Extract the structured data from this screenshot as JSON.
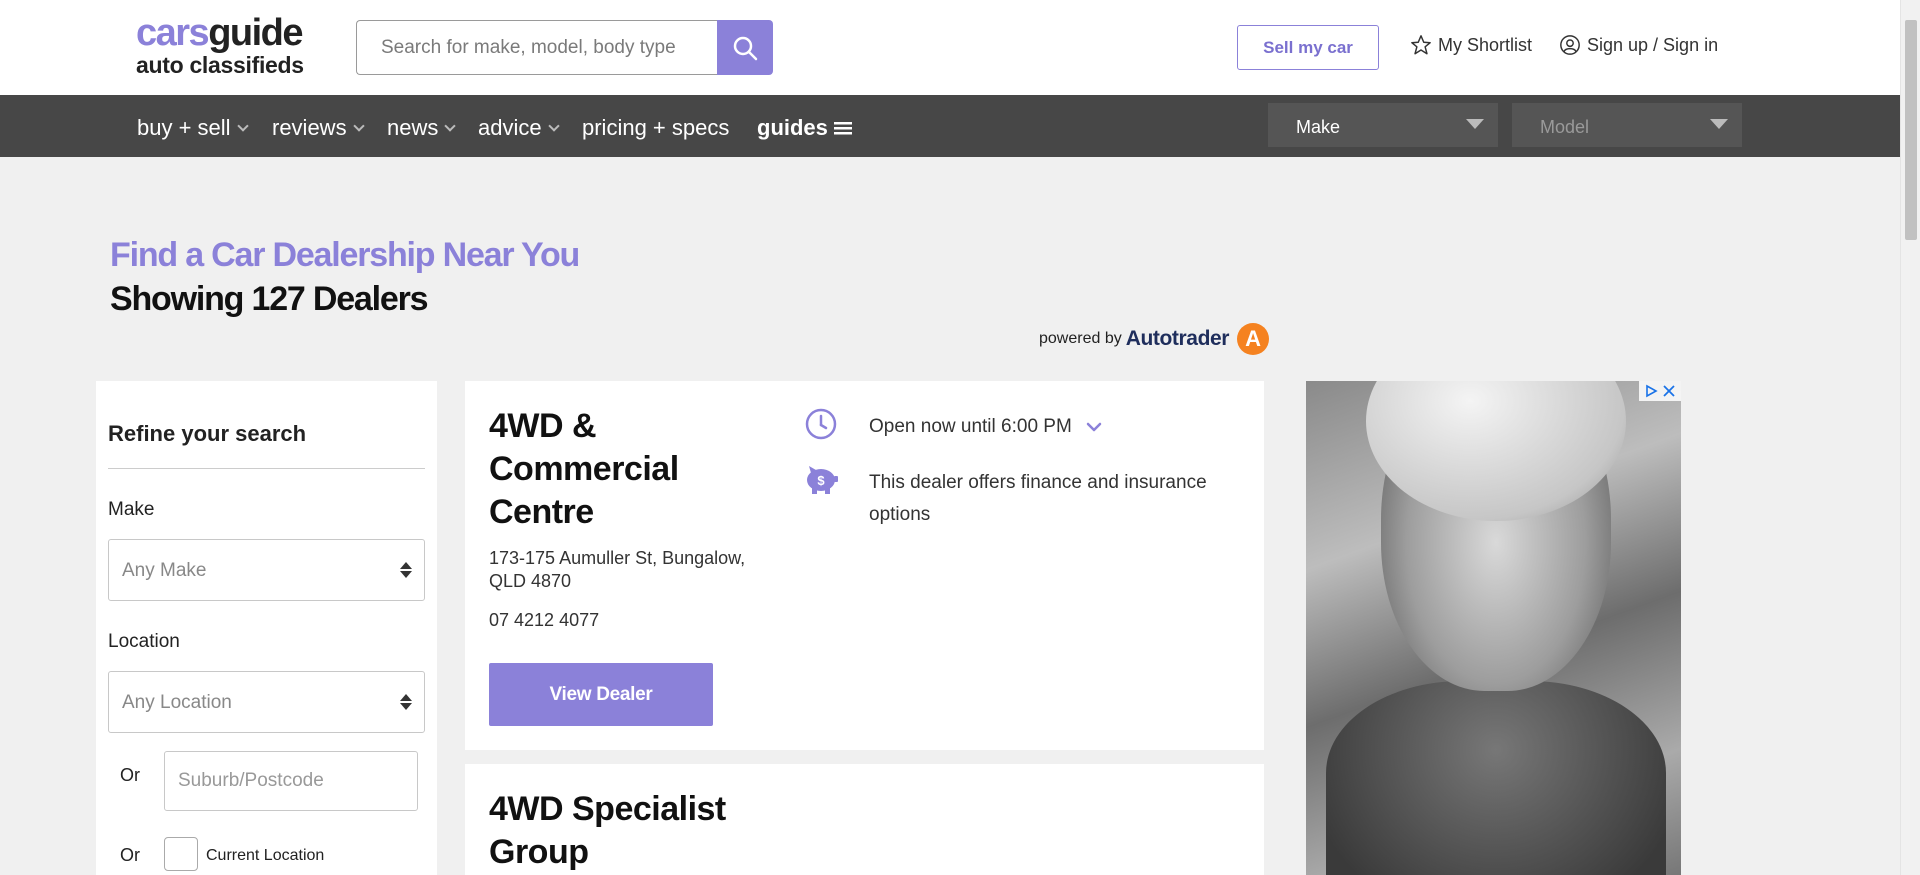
{
  "header": {
    "logo_line1_a": "cars",
    "logo_line1_b": "guide",
    "logo_line2": "auto classifieds",
    "search_placeholder": "Search for make, model, body type",
    "sell_button": "Sell my car",
    "shortlist": "My Shortlist",
    "signin": "Sign up / Sign in"
  },
  "nav": {
    "items": [
      "buy + sell",
      "reviews",
      "news",
      "advice",
      "pricing + specs",
      "guides"
    ],
    "make_select": "Make",
    "model_select": "Model"
  },
  "page": {
    "title": "Find a Car Dealership Near You",
    "subtitle": "Showing 127 Dealers",
    "powered_by": "powered by",
    "powered_brand": "Autotrader"
  },
  "sidebar": {
    "title": "Refine your search",
    "make_label": "Make",
    "make_value": "Any Make",
    "location_label": "Location",
    "location_value": "Any Location",
    "or_label": "Or",
    "suburb_placeholder": "Suburb/Postcode",
    "current_location": "Current Location"
  },
  "dealers": [
    {
      "name": "4WD & Commercial Centre",
      "address": "173-175 Aumuller St, Bungalow, QLD 4870",
      "phone": "07 4212 4077",
      "button": "View Dealer",
      "hours": "Open now until 6:00 PM",
      "finance": "This dealer offers finance and insurance options"
    },
    {
      "name": "4WD Specialist Group"
    }
  ],
  "colors": {
    "brand_purple": "#8b81d9",
    "nav_bg": "#474747",
    "page_bg": "#f0f0f0"
  }
}
